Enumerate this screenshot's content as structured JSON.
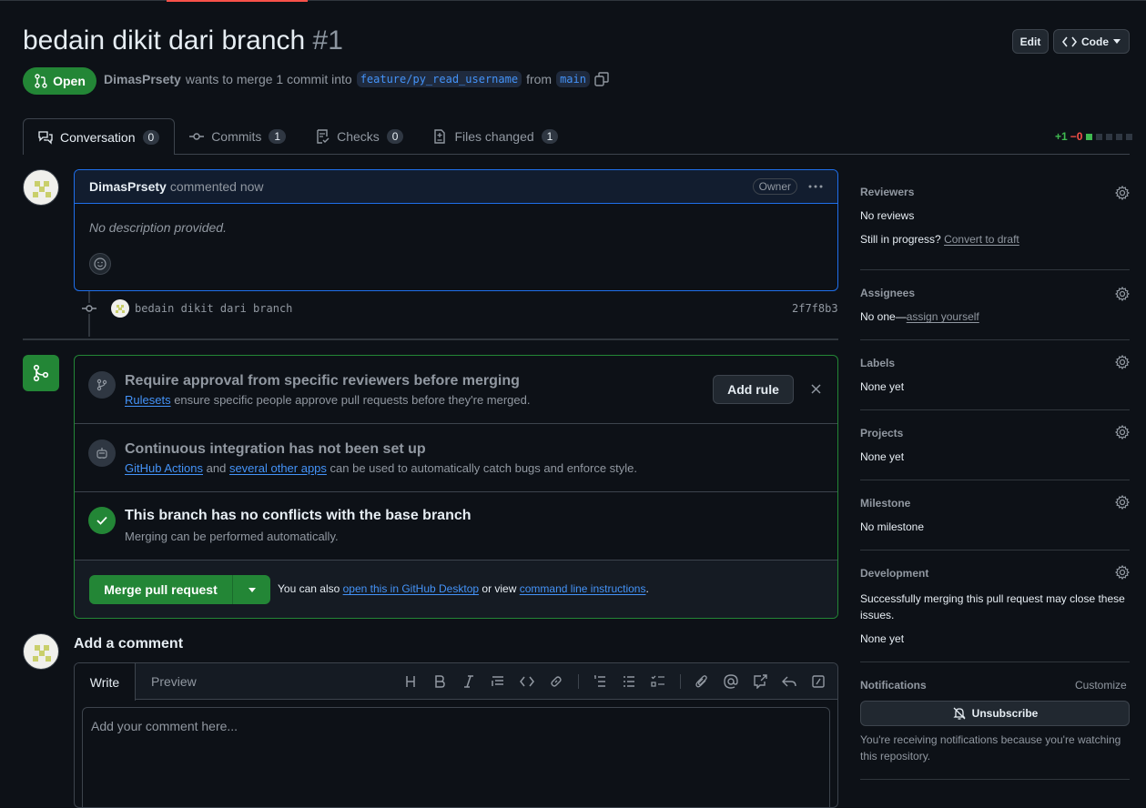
{
  "pr": {
    "title": "bedain dikit dari branch",
    "number": "#1",
    "state": "Open",
    "author": "DimasPrsety",
    "merge_text": "wants to merge 1 commit into",
    "base_branch": "feature/py_read_username",
    "from_text": "from",
    "head_branch": "main"
  },
  "header_buttons": {
    "edit": "Edit",
    "code": "Code"
  },
  "tabs": [
    {
      "label": "Conversation",
      "count": "0"
    },
    {
      "label": "Commits",
      "count": "1"
    },
    {
      "label": "Checks",
      "count": "0"
    },
    {
      "label": "Files changed",
      "count": "1"
    }
  ],
  "diffstat": {
    "added": "+1",
    "removed": "−0"
  },
  "comment": {
    "author": "DimasPrsety",
    "time": "commented now",
    "badge": "Owner",
    "body": "No description provided."
  },
  "commit": {
    "message": "bedain dikit dari branch",
    "sha": "2f7f8b3"
  },
  "merge": {
    "rule_title": "Require approval from specific reviewers before merging",
    "rule_link": "Rulesets",
    "rule_sub": "ensure specific people approve pull requests before they're merged.",
    "add_rule": "Add rule",
    "ci_title": "Continuous integration has not been set up",
    "ci_link1": "GitHub Actions",
    "ci_and": "and",
    "ci_link2": "several other apps",
    "ci_sub": "can be used to automatically catch bugs and enforce style.",
    "conflict_title": "This branch has no conflicts with the base branch",
    "conflict_sub": "Merging can be performed automatically.",
    "merge_button": "Merge pull request",
    "also_text": "You can also",
    "desktop_link": "open this in GitHub Desktop",
    "or_view": "or view",
    "cli_link": "command line instructions",
    "period": "."
  },
  "sidebar": {
    "reviewers": {
      "heading": "Reviewers",
      "value": "No reviews",
      "progress": "Still in progress?",
      "draft_link": "Convert to draft"
    },
    "assignees": {
      "heading": "Assignees",
      "value": "No one—",
      "link": "assign yourself"
    },
    "labels": {
      "heading": "Labels",
      "value": "None yet"
    },
    "projects": {
      "heading": "Projects",
      "value": "None yet"
    },
    "milestone": {
      "heading": "Milestone",
      "value": "No milestone"
    },
    "development": {
      "heading": "Development",
      "desc": "Successfully merging this pull request may close these issues.",
      "value": "None yet"
    },
    "notifications": {
      "heading": "Notifications",
      "customize": "Customize",
      "button": "Unsubscribe",
      "desc": "You're receiving notifications because you're watching this repository."
    }
  },
  "add_comment": {
    "heading": "Add a comment",
    "write_tab": "Write",
    "preview_tab": "Preview",
    "placeholder": "Add your comment here..."
  },
  "colors": {
    "accent": "#238636",
    "link": "#4493f8",
    "bg": "#0d1117",
    "added": "#3fb950",
    "removed": "#f85149"
  }
}
